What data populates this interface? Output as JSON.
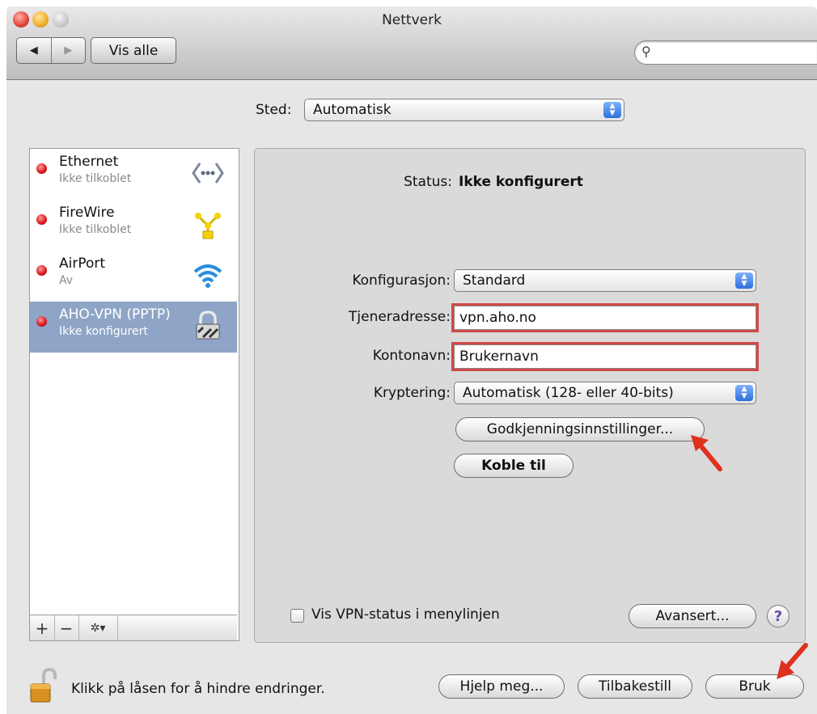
{
  "window": {
    "title": "Nettverk"
  },
  "toolbar": {
    "back": "◀",
    "forward": "▶",
    "show_all": "Vis alle",
    "search_placeholder": ""
  },
  "location": {
    "label": "Sted:",
    "value": "Automatisk"
  },
  "services": [
    {
      "name": "Ethernet",
      "status": "Ikke tilkoblet",
      "icon": "ethernet-icon"
    },
    {
      "name": "FireWire",
      "status": "Ikke tilkoblet",
      "icon": "firewire-icon"
    },
    {
      "name": "AirPort",
      "status": "Av",
      "icon": "wifi-icon"
    },
    {
      "name": "AHO-VPN (PPTP)",
      "status": "Ikke konfigurert",
      "icon": "lock-icon",
      "selected": true
    }
  ],
  "sidebar_buttons": {
    "add": "+",
    "remove": "−",
    "action": "✲▾"
  },
  "detail": {
    "status_label": "Status:",
    "status_value": "Ikke konfigurert",
    "config_label": "Konfigurasjon:",
    "config_value": "Standard",
    "server_label": "Tjeneradresse:",
    "server_value": "vpn.aho.no",
    "account_label": "Kontonavn:",
    "account_value": "Brukernavn",
    "encryption_label": "Kryptering:",
    "encryption_value": "Automatisk (128- eller 40-bits)",
    "auth_button": "Godkjenningsinnstillinger...",
    "connect_button": "Koble til",
    "show_vpn_label": "Vis VPN-status i menylinjen",
    "show_vpn_checked": false,
    "advanced_button": "Avansert...",
    "help": "?"
  },
  "footer": {
    "lock_text": "Klikk på låsen for å hindre endringer.",
    "assist_button": "Hjelp meg...",
    "revert_button": "Tilbakestill",
    "apply_button": "Bruk"
  },
  "colors": {
    "highlight": "#d04848",
    "selection": "#8ea5c7",
    "status_dot": "#d5151b",
    "annotation_arrow": "#e0301e"
  }
}
